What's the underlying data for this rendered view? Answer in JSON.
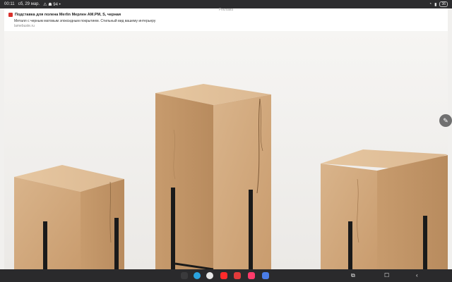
{
  "status_bar": {
    "time": "00:11",
    "date": "сб, 29 мар.",
    "notifications": "⚠ ☗ 94 •",
    "battery": "36"
  },
  "ad": {
    "label": "Реклама",
    "title": "Подставка для полена Merlin Мерлен AM.PM, S, черная",
    "description": "Металл с черным матовым эпоксидным покрытием. Стильный вид вашему интерьеру",
    "domain": "lamebuste.ru"
  },
  "photo": {
    "subject": "wooden-block-stools-on-black-metal-stands"
  },
  "floating": {
    "edit_icon": "pencil-icon"
  },
  "dock": {
    "apps": [
      {
        "icon": "apps-grid-icon",
        "color": "#3a3a3c"
      },
      {
        "icon": "telegram-icon",
        "color": "#2aa3df"
      },
      {
        "icon": "chrome-icon",
        "color": "#e8e8e8"
      },
      {
        "icon": "youtube-icon",
        "color": "#ff2b2b"
      },
      {
        "icon": "recorder-icon",
        "color": "#e23a3a"
      },
      {
        "icon": "music-icon",
        "color": "#ff3b6b"
      },
      {
        "icon": "calendar-icon",
        "color": "#4a7de8"
      }
    ],
    "system": [
      "recent-apps-icon",
      "home-icon",
      "back-icon"
    ]
  }
}
